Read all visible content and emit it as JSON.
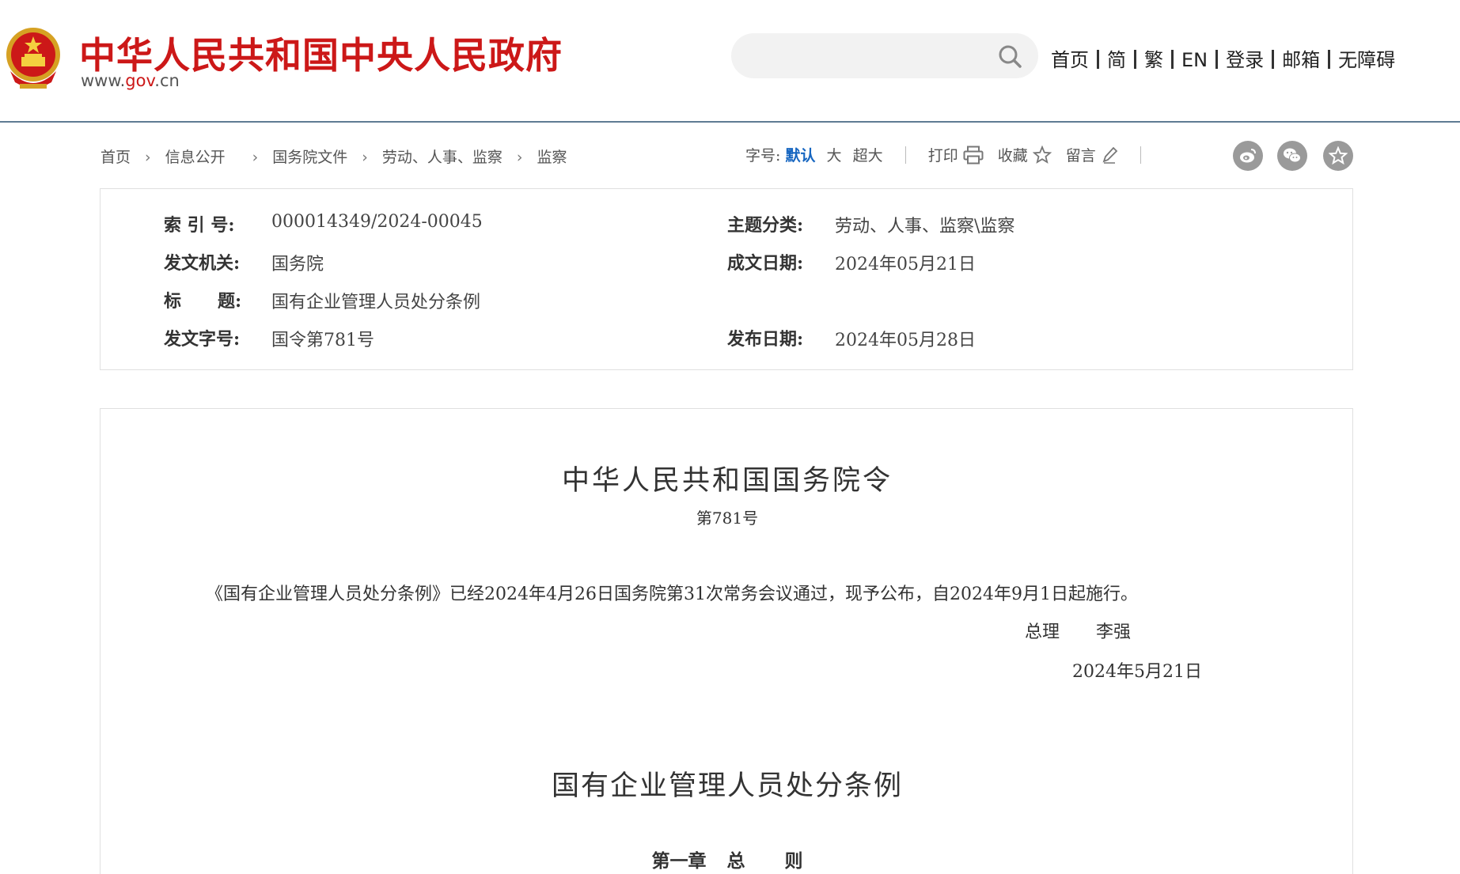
{
  "header": {
    "site_title": "中华人民共和国中央人民政府",
    "domain_prefix": "www.",
    "domain_gov": "gov",
    "domain_suffix": ".cn",
    "search_placeholder": "",
    "nav": [
      "首页",
      "简",
      "繁",
      "EN",
      "登录",
      "邮箱",
      "无障碍"
    ]
  },
  "breadcrumb": [
    "首页",
    "信息公开",
    "国务院文件",
    "劳动、人事、监察",
    "监察"
  ],
  "tools": {
    "font_label": "字号:",
    "font_default": "默认",
    "font_large": "大",
    "font_xlarge": "超大",
    "print": "打印",
    "favorite": "收藏",
    "comment": "留言"
  },
  "share_icons": [
    "weibo-icon",
    "wechat-icon",
    "favorite-star-icon"
  ],
  "info": {
    "index_label": "索 引 号:",
    "index_value": "000014349/2024-00045",
    "topic_label": "主题分类:",
    "topic_value": "劳动、人事、监察\\监察",
    "issuer_label": "发文机关:",
    "issuer_value": "国务院",
    "written_label": "成文日期:",
    "written_value": "2024年05月21日",
    "title_label": "标      题:",
    "title_value": "国有企业管理人员处分条例",
    "docno_label": "发文字号:",
    "docno_value": "国令第781号",
    "publish_label": "发布日期:",
    "publish_value": "2024年05月28日"
  },
  "article": {
    "order_title": "中华人民共和国国务院令",
    "order_no": "第781号",
    "paragraph": "《国有企业管理人员处分条例》已经2024年4月26日国务院第31次常务会议通过，现予公布，自2024年9月1日起施行。",
    "signer_title": "总理",
    "signer_name": "李强",
    "sign_date": "2024年5月21日",
    "regulation_title": "国有企业管理人员处分条例",
    "chapter_no": "第一章",
    "chapter_name_1": "总",
    "chapter_name_2": "则"
  },
  "colors": {
    "brand_red": "#cc1818",
    "active_blue": "#1565c0",
    "header_rule": "#5f7b93"
  }
}
